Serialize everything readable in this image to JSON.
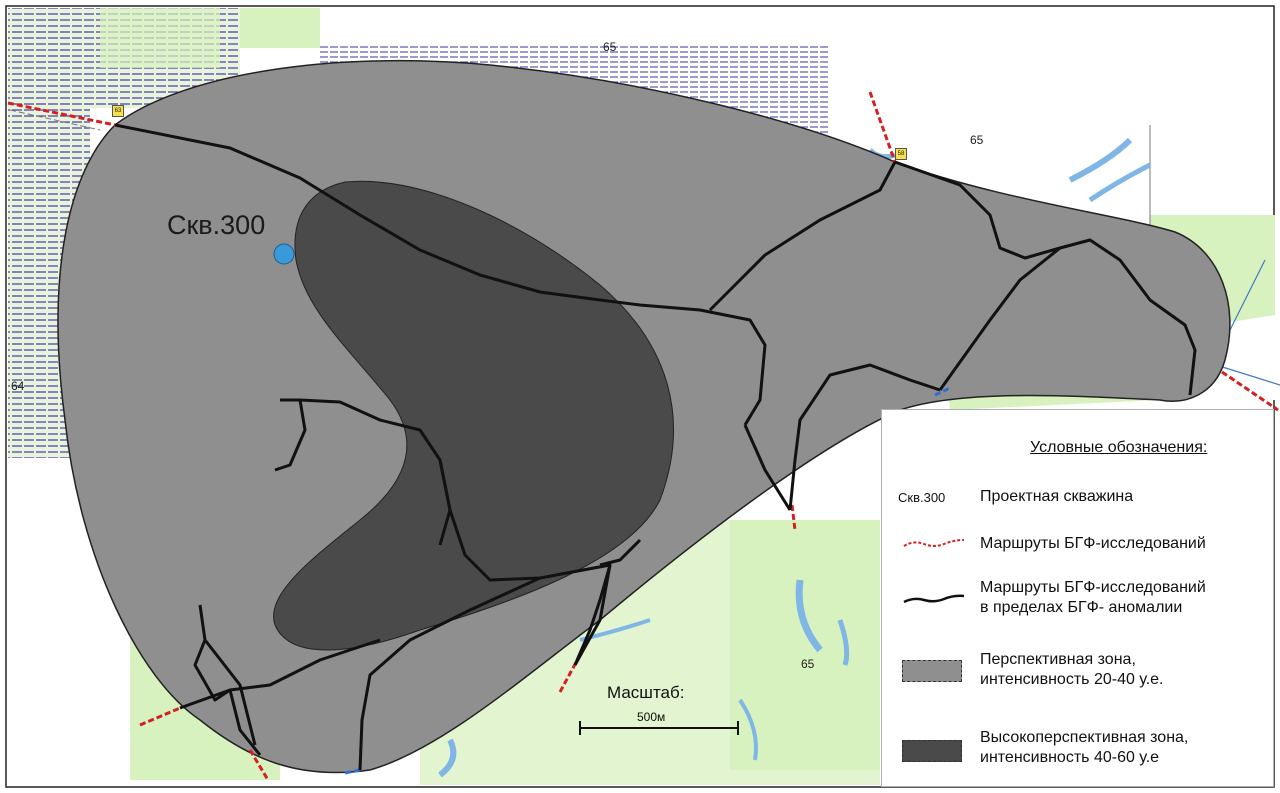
{
  "well": {
    "label": "Скв.300",
    "color": "#3a9ad9"
  },
  "map_labels": [
    {
      "name": "elevation-label-65-top",
      "text": "65"
    },
    {
      "name": "elevation-label-65-right",
      "text": "65"
    },
    {
      "name": "elevation-label-64",
      "text": "64"
    },
    {
      "name": "elevation-label-65-bottom",
      "text": "65"
    }
  ],
  "road_tags": [
    "63",
    "58"
  ],
  "scale": {
    "title": "Масштаб:",
    "label": "500м"
  },
  "legend": {
    "title": "Условные обозначения:",
    "items": [
      {
        "name": "legend-well",
        "symbol_text": "Скв.300",
        "label": "Проектная скважина"
      },
      {
        "name": "legend-routes",
        "label": "Маршруты БГФ-исследований"
      },
      {
        "name": "legend-routes-anomaly",
        "label": "Маршруты БГФ-исследований\nв пределах БГФ- аномалии"
      },
      {
        "name": "legend-perspective-zone",
        "label": "Перспективная зона,\nинтенсивность 20-40 у.е."
      },
      {
        "name": "legend-high-perspective-zone",
        "label": "Высокоперспективная зона,\nинтенсивность 40-60 у.е"
      }
    ]
  },
  "colors": {
    "perspective_zone": "#8f8f8f",
    "high_perspective_zone": "#4a4a4a",
    "route_red": "#d42020",
    "route_black": "#111111",
    "forest_green": "#d8f2bf",
    "water_blue": "#7fb6e6",
    "marsh_hatch": "#4c4ca8"
  }
}
